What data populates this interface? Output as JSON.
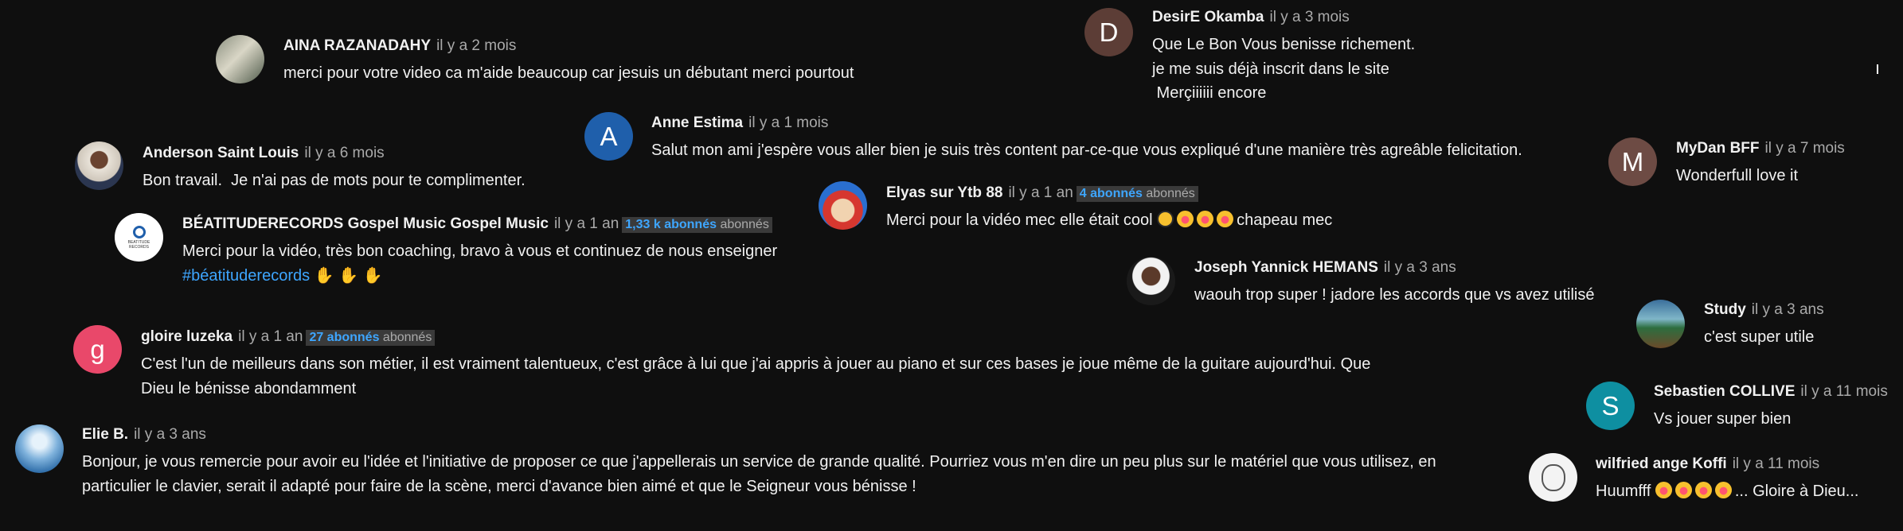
{
  "colors": {
    "background": "#0f0f0f",
    "text": "#f1f1f1",
    "meta": "#aaaaaa",
    "link": "#3ea6ff"
  },
  "comments": [
    {
      "author": "AINA RAZANADAHY",
      "time": "il y a 2 mois",
      "avatar_kind": "photo",
      "lines": [
        "merci pour votre video  ca m'aide beaucoup car jesuis un débutant merci pourtout"
      ]
    },
    {
      "author": "DesirE Okamba",
      "time": "il y a 3 mois",
      "avatar_letter": "D",
      "avatar_color": "#5c3d36",
      "lines": [
        "Que Le Bon Vous benisse richement.",
        "je me suis déjà inscrit dans le site",
        " Merçiiiiii encore"
      ]
    },
    {
      "author": "Anne Estima",
      "time": "il y a 1 mois",
      "avatar_letter": "A",
      "avatar_color": "#1f5fab",
      "lines": [
        "Salut mon ami j'espère vous aller bien je suis très content par-ce-que vous expliqué d'une manière très agreâble felicitation."
      ]
    },
    {
      "author": "Anderson Saint Louis",
      "time": "il y a 6 mois",
      "avatar_kind": "photo",
      "lines": [
        "Bon travail.  Je n'ai pas de mots pour te complimenter."
      ]
    },
    {
      "author": "MyDan BFF",
      "time": "il y a 7 mois",
      "avatar_letter": "M",
      "avatar_color": "#6d4b44",
      "lines": [
        "Wonderfull love it"
      ]
    },
    {
      "author": "Elyas sur Ytb 88",
      "time": "il y a 1 an",
      "subs_num": "4 abonnés",
      "subs_label": "abonnés",
      "avatar_kind": "cartoon",
      "text_before": "Merci pour la vidéo mec elle était cool",
      "text_after": "chapeau mec"
    },
    {
      "author": "BÉATITUDERECORDS Gospel Music Gospel Music",
      "time": "il y a 1 an",
      "subs_num": "1,33 k abonnés",
      "subs_label": "abonnés",
      "avatar_kind": "logo",
      "avatar_text": "BEATITUDE RECORDS",
      "lines": [
        "Merci pour la vidéo, très bon coaching, bravo à vous et continuez de nous enseigner"
      ],
      "hashtag": "#béatituderecords"
    },
    {
      "author": "Joseph Yannick HEMANS",
      "time": "il y a 3 ans",
      "avatar_kind": "photo",
      "lines": [
        "waouh trop super ! jadore les accords que vs avez utilisé"
      ]
    },
    {
      "author": "Study",
      "time": "il y a 3 ans",
      "avatar_kind": "landscape",
      "lines": [
        "c'est super utile"
      ]
    },
    {
      "author": "gloire luzeka",
      "time": "il y a 1 an",
      "subs_num": "27 abonnés",
      "subs_label": "abonnés",
      "avatar_letter": "g",
      "avatar_color": "#e9486a",
      "text": "C'est l'un de meilleurs dans son métier, il est vraiment talentueux, c'est grâce à lui que j'ai appris à jouer au piano et sur ces bases je joue même de la guitare aujourd'hui. Que Dieu le bénisse abondamment"
    },
    {
      "author": "Sebastien COLLIVE",
      "time": "il y a 11 mois",
      "avatar_letter": "S",
      "avatar_color": "#0e8fa1",
      "lines": [
        "Vs jouer super bien"
      ]
    },
    {
      "author": "Elie B.",
      "time": "il y a 3 ans",
      "avatar_kind": "sky",
      "text": "Bonjour, je vous remercie pour avoir eu l'idée et l'initiative de proposer ce que j'appellerais un service de grande qualité. Pourriez vous m'en dire un peu plus sur le matériel que vous utilisez, en particulier le clavier, serait il adapté pour faire de la scène, merci d'avance bien aimé et que le Seigneur vous bénisse !"
    },
    {
      "author": "wilfried ange Koffi",
      "time": "il y a 11 mois",
      "avatar_kind": "drawing",
      "text_before": "Huumfff",
      "text_after": "... Gloire à Dieu..."
    }
  ]
}
